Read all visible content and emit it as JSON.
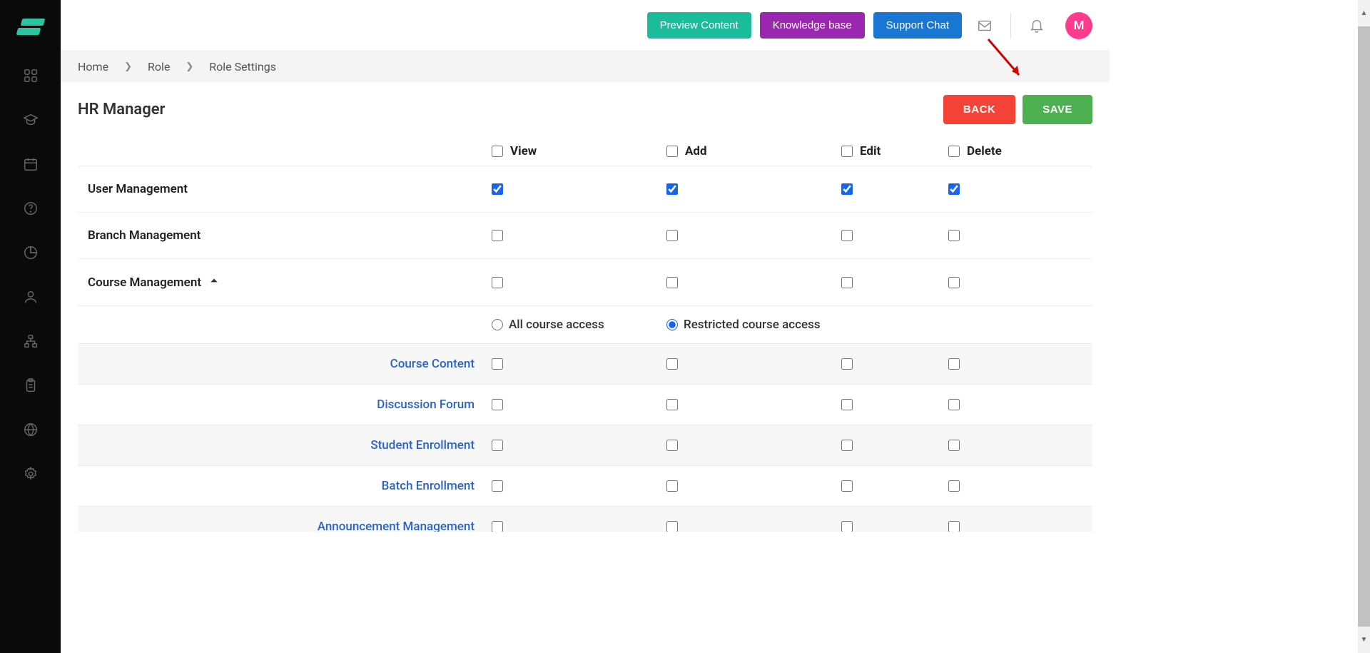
{
  "header": {
    "preview_label": "Preview Content",
    "kb_label": "Knowledge base",
    "support_label": "Support Chat",
    "avatar_initial": "M"
  },
  "breadcrumb": {
    "home": "Home",
    "role": "Role",
    "current": "Role Settings"
  },
  "page": {
    "title": "HR Manager",
    "back_label": "BACK",
    "save_label": "SAVE"
  },
  "columns": {
    "view": "View",
    "add": "Add",
    "edit": "Edit",
    "delete": "Delete"
  },
  "modules": {
    "user_mgmt": "User Management",
    "branch_mgmt": "Branch Management",
    "course_mgmt": "Course Management"
  },
  "course_access": {
    "all": "All course access",
    "restricted": "Restricted course access"
  },
  "subitems": {
    "course_content": "Course Content",
    "discussion_forum": "Discussion Forum",
    "student_enrollment": "Student Enrollment",
    "batch_enrollment": "Batch Enrollment",
    "announcement_mgmt": "Announcement Management"
  }
}
